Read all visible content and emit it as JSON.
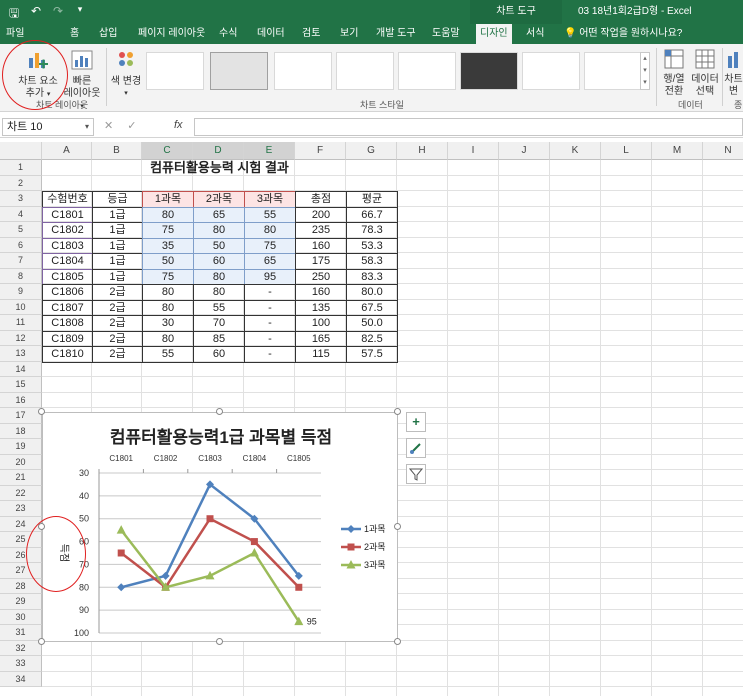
{
  "titlebar": {
    "chart_tools": "차트 도구",
    "doc_title": "03 18년1회2급D형 - Excel"
  },
  "tabs": [
    {
      "label": "파일"
    },
    {
      "label": "홈"
    },
    {
      "label": "삽입"
    },
    {
      "label": "페이지 레이아웃"
    },
    {
      "label": "수식"
    },
    {
      "label": "데이터"
    },
    {
      "label": "검토"
    },
    {
      "label": "보기"
    },
    {
      "label": "개발 도구"
    },
    {
      "label": "도움말"
    },
    {
      "label": "디자인"
    },
    {
      "label": "서식"
    }
  ],
  "tell_me": "어떤 작업을 원하시나요?",
  "ribbon": {
    "add_element": "차트 요소",
    "add_element2": "추가",
    "quick_layout": "빠른",
    "quick_layout2": "레이아웃",
    "change_color": "색 변경",
    "group_layouts": "차트 레이아웃",
    "group_styles": "차트 스타일",
    "switch_rowcol": "행/열",
    "switch_rowcol2": "전환",
    "select_data": "데이터",
    "select_data2": "선택",
    "group_data": "데이터",
    "change_type": "차트",
    "change_type2": "변",
    "group_type": "종"
  },
  "formula_bar": {
    "name_box": "차트 10",
    "fx": "fx"
  },
  "columns": [
    "A",
    "B",
    "C",
    "D",
    "E",
    "F",
    "G",
    "H",
    "I",
    "J",
    "K",
    "L",
    "M",
    "N"
  ],
  "rows": [
    "1",
    "2",
    "3",
    "4",
    "5",
    "6",
    "7",
    "8",
    "9",
    "10",
    "11",
    "12",
    "13",
    "14",
    "15",
    "16",
    "17",
    "18",
    "19",
    "20",
    "21",
    "22",
    "23",
    "24",
    "25",
    "26",
    "27",
    "28",
    "29",
    "30",
    "31",
    "32",
    "33",
    "34"
  ],
  "sheet": {
    "title": "컴퓨터활용능력 시험 결과",
    "headers": [
      "수험번호",
      "등급",
      "1과목",
      "2과목",
      "3과목",
      "총점",
      "평균"
    ],
    "data": [
      [
        "C1801",
        "1급",
        "80",
        "65",
        "55",
        "200",
        "66.7"
      ],
      [
        "C1802",
        "1급",
        "75",
        "80",
        "80",
        "235",
        "78.3"
      ],
      [
        "C1803",
        "1급",
        "35",
        "50",
        "75",
        "160",
        "53.3"
      ],
      [
        "C1804",
        "1급",
        "50",
        "60",
        "65",
        "175",
        "58.3"
      ],
      [
        "C1805",
        "1급",
        "75",
        "80",
        "95",
        "250",
        "83.3"
      ],
      [
        "C1806",
        "2급",
        "80",
        "80",
        "-",
        "160",
        "80.0"
      ],
      [
        "C1807",
        "2급",
        "80",
        "55",
        "-",
        "135",
        "67.5"
      ],
      [
        "C1808",
        "2급",
        "30",
        "70",
        "-",
        "100",
        "50.0"
      ],
      [
        "C1809",
        "2급",
        "80",
        "85",
        "-",
        "165",
        "82.5"
      ],
      [
        "C1810",
        "2급",
        "55",
        "60",
        "-",
        "115",
        "57.5"
      ]
    ]
  },
  "chart_data": {
    "type": "line",
    "title": "컴퓨터활용능력1급 과목별 득점",
    "categories": [
      "C1801",
      "C1802",
      "C1803",
      "C1804",
      "C1805"
    ],
    "series": [
      {
        "name": "1과목",
        "values": [
          80,
          75,
          35,
          50,
          75
        ],
        "color": "#4f81bd",
        "marker": "diamond"
      },
      {
        "name": "2과목",
        "values": [
          65,
          80,
          50,
          60,
          80
        ],
        "color": "#c0504d",
        "marker": "square"
      },
      {
        "name": "3과목",
        "values": [
          55,
          80,
          75,
          65,
          95
        ],
        "color": "#9bbb59",
        "marker": "triangle"
      }
    ],
    "ylabel": "득점",
    "ylim": [
      30,
      100
    ],
    "y_reversed": true,
    "y_ticks": [
      30,
      40,
      50,
      60,
      70,
      80,
      90,
      100
    ],
    "x_axis_position": "top",
    "grid": true,
    "legend": "right",
    "annotation": "95"
  }
}
